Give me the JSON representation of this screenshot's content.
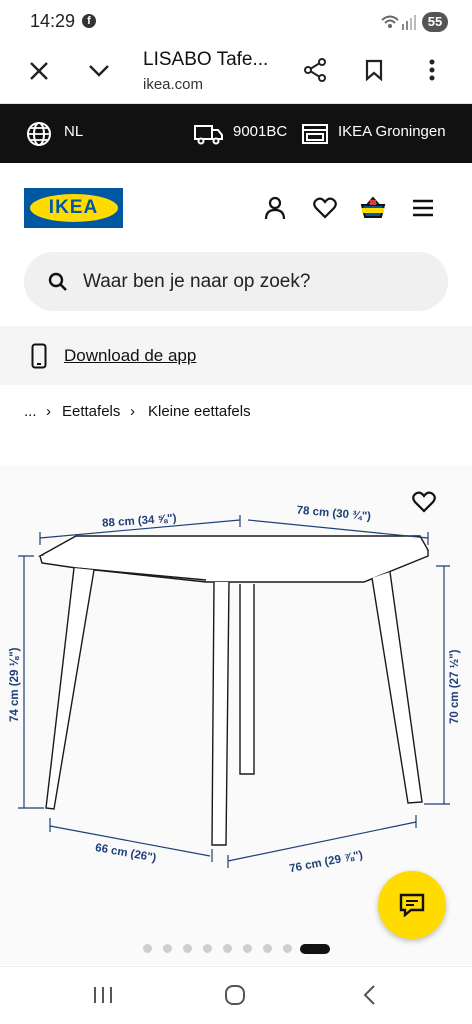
{
  "status_bar": {
    "time": "14:29",
    "battery": "55"
  },
  "browser": {
    "title": "LISABO Tafe...",
    "url": "ikea.com"
  },
  "info_bar": {
    "language": "NL",
    "postal_code": "9001BC",
    "store": "IKEA Groningen"
  },
  "header": {
    "logo_text": "IKEA"
  },
  "search": {
    "placeholder": "Waar ben je naar op zoek?"
  },
  "app_banner": {
    "label": "Download de app"
  },
  "breadcrumb": {
    "ellipsis": "...",
    "items": [
      "Eettafels",
      "Kleine eettafels"
    ]
  },
  "product_image": {
    "dimensions": {
      "top_width": "88 cm (34 ⅝\")",
      "top_depth": "78 cm (30 ¾\")",
      "height_total": "74 cm (29 ⅛\")",
      "height_under": "70 cm (27 ½\")",
      "leg_width": "66 cm (26\")",
      "leg_depth": "76 cm (29 ⅞\")"
    },
    "carousel": {
      "total": 9,
      "active_index": 8
    }
  },
  "colors": {
    "ikea_blue": "#0058a3",
    "ikea_yellow": "#ffdb00",
    "dimension_blue": "#1f3f78"
  }
}
